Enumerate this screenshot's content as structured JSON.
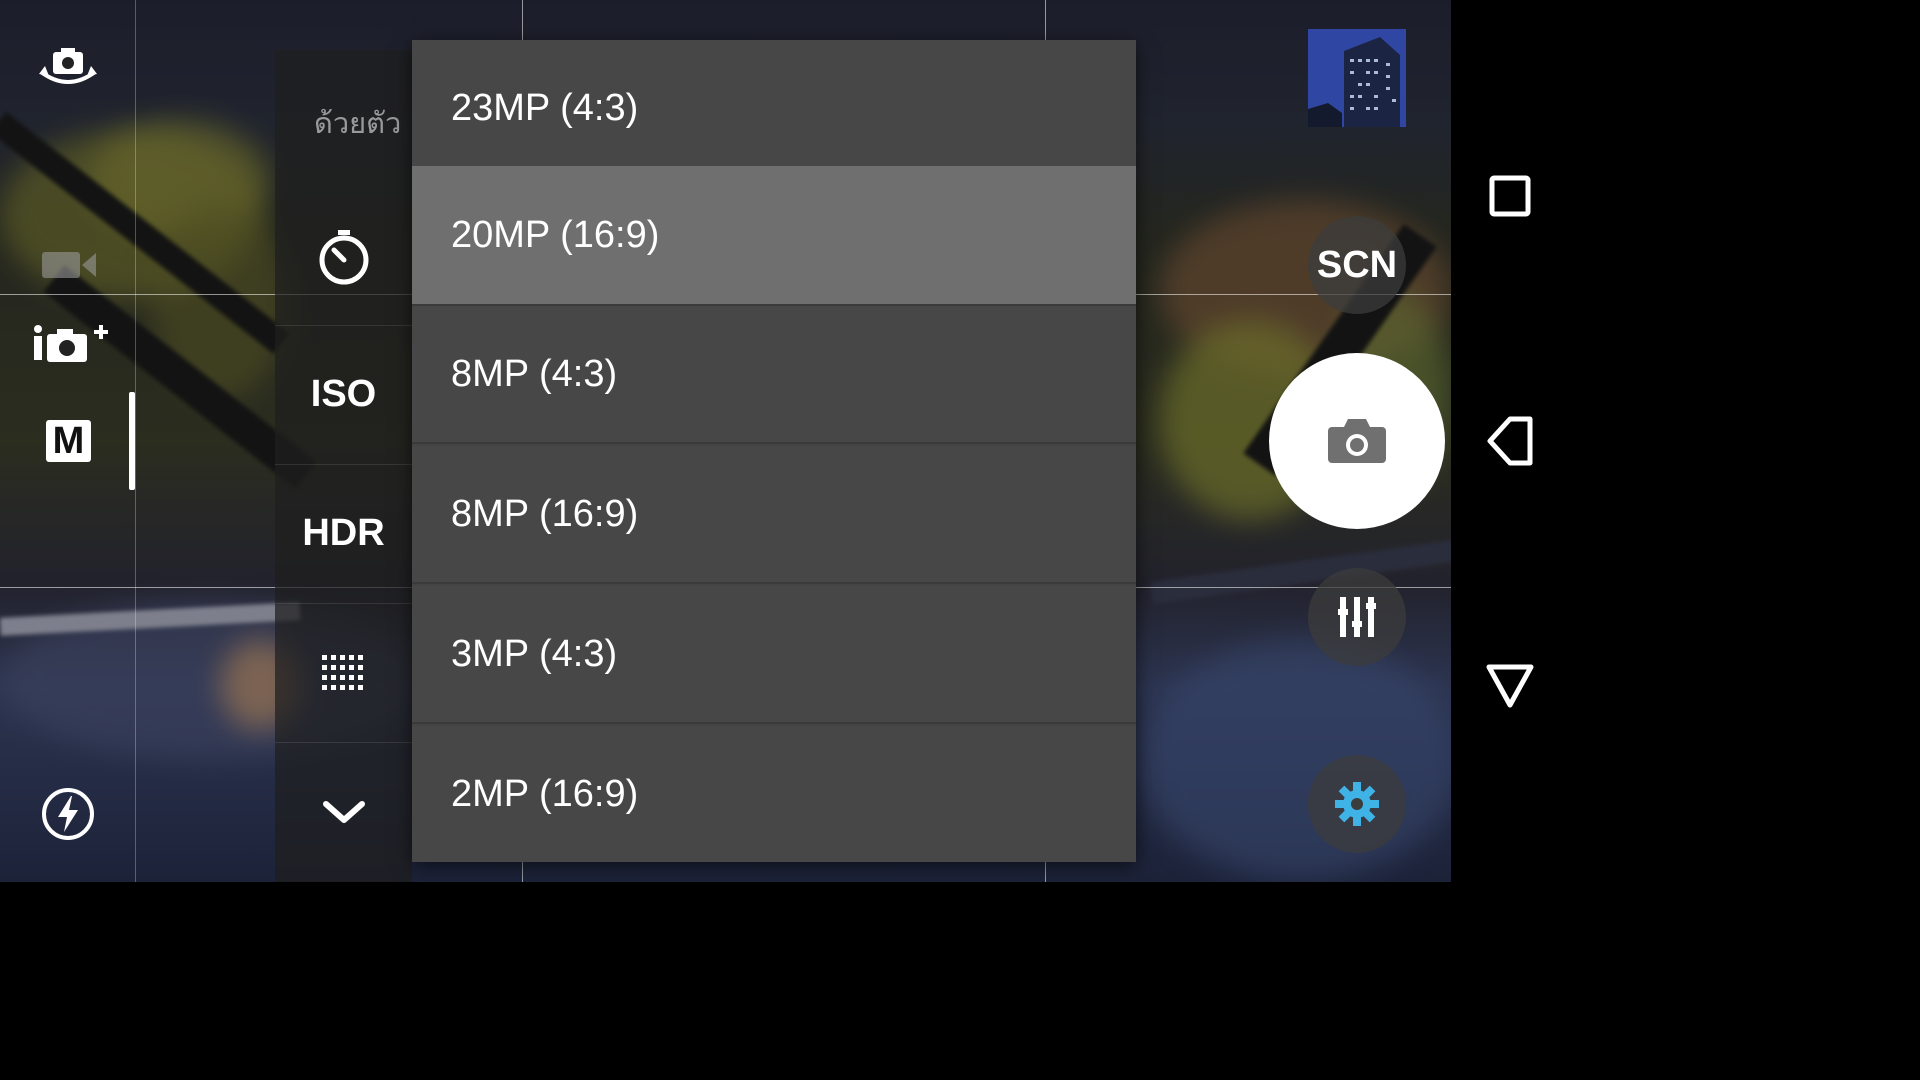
{
  "app": {
    "name": "Camera"
  },
  "left_rail": {
    "switch_camera_icon": "switch-camera-icon",
    "video_icon": "video-camera-icon",
    "superior_auto_icon": "superior-auto-icon",
    "manual_label": "M",
    "flash_icon": "flash-auto-icon"
  },
  "settings_panel": {
    "truncated_label": "ด้วยตัว",
    "timer_icon": "self-timer-icon",
    "iso_label": "ISO",
    "hdr_label": "HDR",
    "grid_icon": "grid-lines-icon",
    "more_icon": "chevron-down-icon"
  },
  "resolution_menu": {
    "options": [
      {
        "label": "23MP (4:3)",
        "selected": false
      },
      {
        "label": "20MP (16:9)",
        "selected": true
      },
      {
        "label": "8MP (4:3)",
        "selected": false
      },
      {
        "label": "8MP (16:9)",
        "selected": false
      },
      {
        "label": "3MP (4:3)",
        "selected": false
      },
      {
        "label": "2MP (16:9)",
        "selected": false
      }
    ]
  },
  "right_controls": {
    "thumbnail_icon": "last-photo-thumbnail",
    "scene_label": "SCN",
    "shutter_icon": "camera-icon",
    "adjust_icon": "adjustment-sliders-icon",
    "settings_icon": "gear-icon"
  },
  "nav_bar": {
    "recents_icon": "recents-square-icon",
    "back_icon": "back-triangle-icon",
    "home_icon": "home-triangle-icon"
  },
  "colors": {
    "menu_bg": "#474747",
    "menu_selected": "#6f6f6f",
    "gear_accent": "#3fb2e6",
    "shutter_bg": "#ffffff"
  }
}
